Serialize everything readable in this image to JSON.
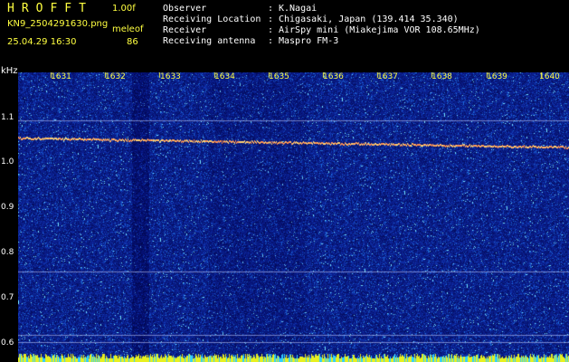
{
  "header": {
    "app_title": "HROFFT",
    "version": "1.00f",
    "filename": "KN9_2504291630.png",
    "unit_label": "meleof",
    "datetime": "25.04.29 16:30",
    "count": "86"
  },
  "info": [
    {
      "label": "Observer",
      "sep": ":",
      "value": "K.Nagai"
    },
    {
      "label": "Receiving Location",
      "sep": ":",
      "value": "Chigasaki, Japan (139.414 35.340)"
    },
    {
      "label": "Receiver",
      "sep": ":",
      "value": "AirSpy mini (Miakejima VOR 108.65MHz)"
    },
    {
      "label": "Receiving antenna",
      "sep": ":",
      "value": "Maspro FM-3"
    }
  ],
  "axes": {
    "y_unit": "kHz",
    "y_ticks": [
      "1.1",
      "1.0",
      "0.9",
      "0.8",
      "0.7",
      "0.6"
    ],
    "x_ticks": [
      "1631",
      "1632",
      "1633",
      "1634",
      "1635",
      "1636",
      "1637",
      "1638",
      "1639",
      "1640"
    ]
  },
  "colors": {
    "background": "#000000",
    "spectrogram_base": "#0a1f8f",
    "header_yellow": "#ffff40",
    "grid_line": "#c8d0ff",
    "signal": "#ff8040"
  }
}
